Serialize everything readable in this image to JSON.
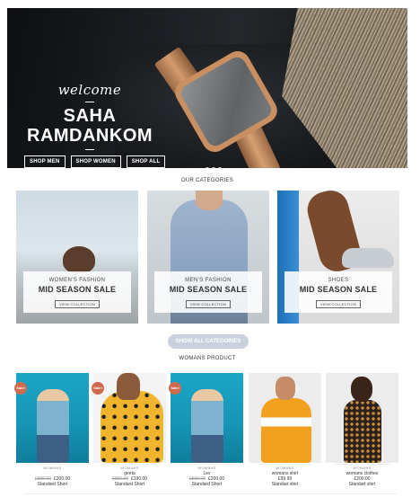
{
  "hero": {
    "welcome": "welcome",
    "brand_line1": "SAHA",
    "brand_line2": "RAMDANKOM",
    "buttons": [
      "SHOP MEN",
      "SHOP WOMEN",
      "SHOP ALL"
    ],
    "slide_count": 3,
    "active_slide": 1
  },
  "categories_title": "OUR CATEGORIES",
  "categories": [
    {
      "sub": "WOMEN'S FASHION",
      "main": "MID SEASON SALE",
      "button": "VIEW COLLECTION"
    },
    {
      "sub": "MEN'S FASHION",
      "main": "MID SEASON SALE",
      "button": "VIEW COLLECTION"
    },
    {
      "sub": "SHOES",
      "main": "MID SEASON SALE",
      "button": "VIEW COLLECTION"
    }
  ],
  "show_all_label": "SHOW ALL CATEGORIES",
  "products_title": "WOMANS PRODUCT",
  "products": [
    {
      "sale": "Sale!",
      "category": "WOMANS",
      "name": "",
      "old_price": "£500.00",
      "price": "£200.00",
      "size": "Standard Short"
    },
    {
      "sale": "Sale!",
      "category": "WOMANS",
      "name": "geeta",
      "old_price": "£350.00",
      "price": "£190.00",
      "size": "Standard Short"
    },
    {
      "sale": "Sale!",
      "category": "WOMANS",
      "name": "Lev",
      "old_price": "£500.00",
      "price": "£200.00",
      "size": "Standard Short"
    },
    {
      "sale": "",
      "category": "WOMANS",
      "name": "womans shirt",
      "old_price": "",
      "price": "£99.99",
      "size": "Standart shirt"
    },
    {
      "sale": "",
      "category": "WOMANS",
      "name": "womans clothes",
      "old_price": "",
      "price": "£200.00",
      "size": "Standart shirt"
    }
  ],
  "colors": {
    "sale_badge": "#cf6a4e",
    "show_all_bg": "#c9d2dc"
  }
}
